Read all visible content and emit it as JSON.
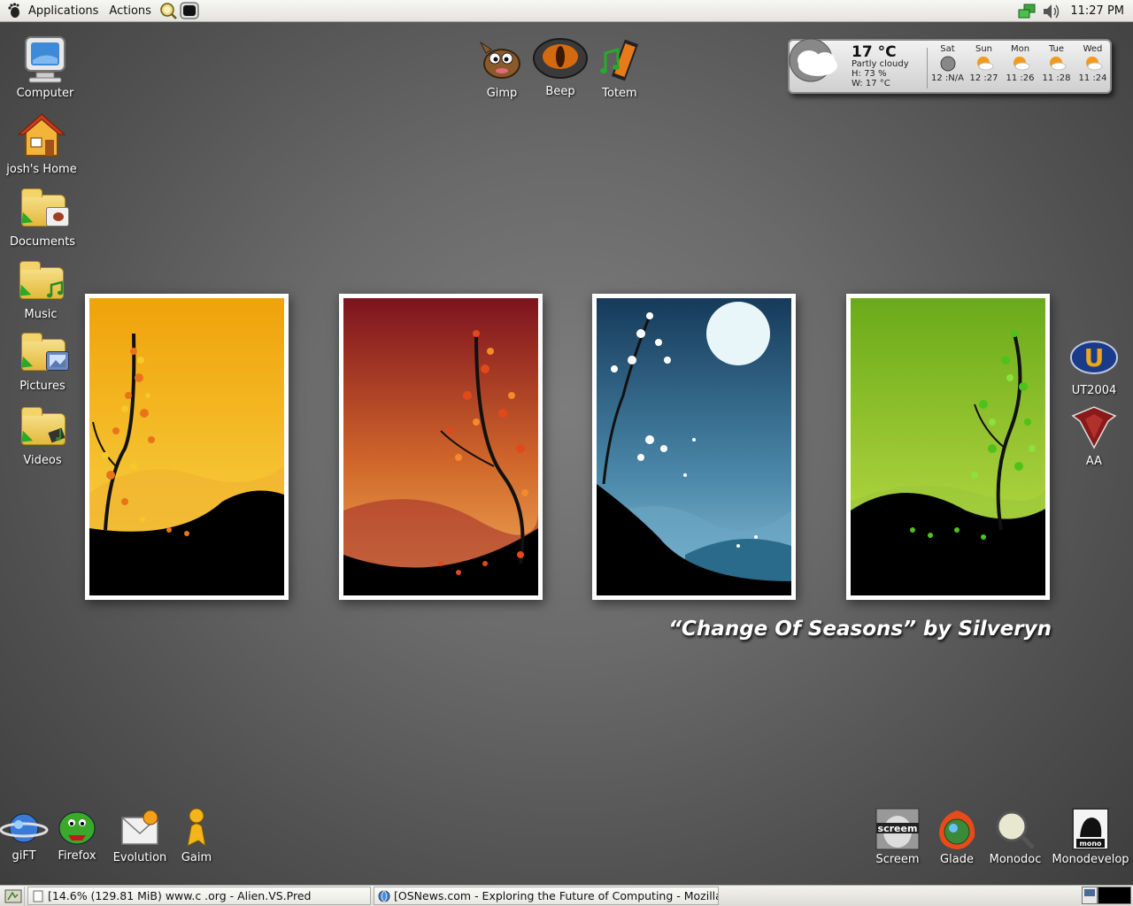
{
  "top_panel": {
    "menus": [
      "Applications",
      "Actions"
    ],
    "clock": "11:27 PM"
  },
  "desktop_left": [
    {
      "label": "Computer"
    },
    {
      "label": "josh's Home"
    },
    {
      "label": "Documents"
    },
    {
      "label": "Music"
    },
    {
      "label": "Pictures"
    },
    {
      "label": "Videos"
    }
  ],
  "desktop_top": [
    {
      "label": "Gimp"
    },
    {
      "label": "Beep"
    },
    {
      "label": "Totem"
    }
  ],
  "desktop_right": [
    {
      "label": "UT2004"
    },
    {
      "label": "AA"
    }
  ],
  "desktop_bottom_left": [
    {
      "label": "giFT"
    },
    {
      "label": "Firefox"
    },
    {
      "label": "Evolution"
    },
    {
      "label": "Gaim"
    }
  ],
  "desktop_bottom_right": [
    {
      "label": "Screem"
    },
    {
      "label": "Glade"
    },
    {
      "label": "Monodoc"
    },
    {
      "label": "Monodevelop"
    }
  ],
  "weather": {
    "temp": "17 °C",
    "description": "Partly cloudy",
    "humidity": "H: 73 %",
    "wind": "W: 17 °C",
    "forecast": [
      {
        "day": "Sat",
        "temp": "12 :N/A"
      },
      {
        "day": "Sun",
        "temp": "12 :27"
      },
      {
        "day": "Mon",
        "temp": "11 :26"
      },
      {
        "day": "Tue",
        "temp": "11 :28"
      },
      {
        "day": "Wed",
        "temp": "11 :24"
      }
    ]
  },
  "wallpaper": {
    "credit": "“Change Of Seasons” by Silveryn"
  },
  "taskbar": {
    "tasks": [
      {
        "label": "[14.6% (129.81 MiB) www.c        .org - Alien.VS.Pred"
      },
      {
        "label": "[OSNews.com - Exploring the Future of Computing - Mozilla Fi"
      }
    ]
  }
}
